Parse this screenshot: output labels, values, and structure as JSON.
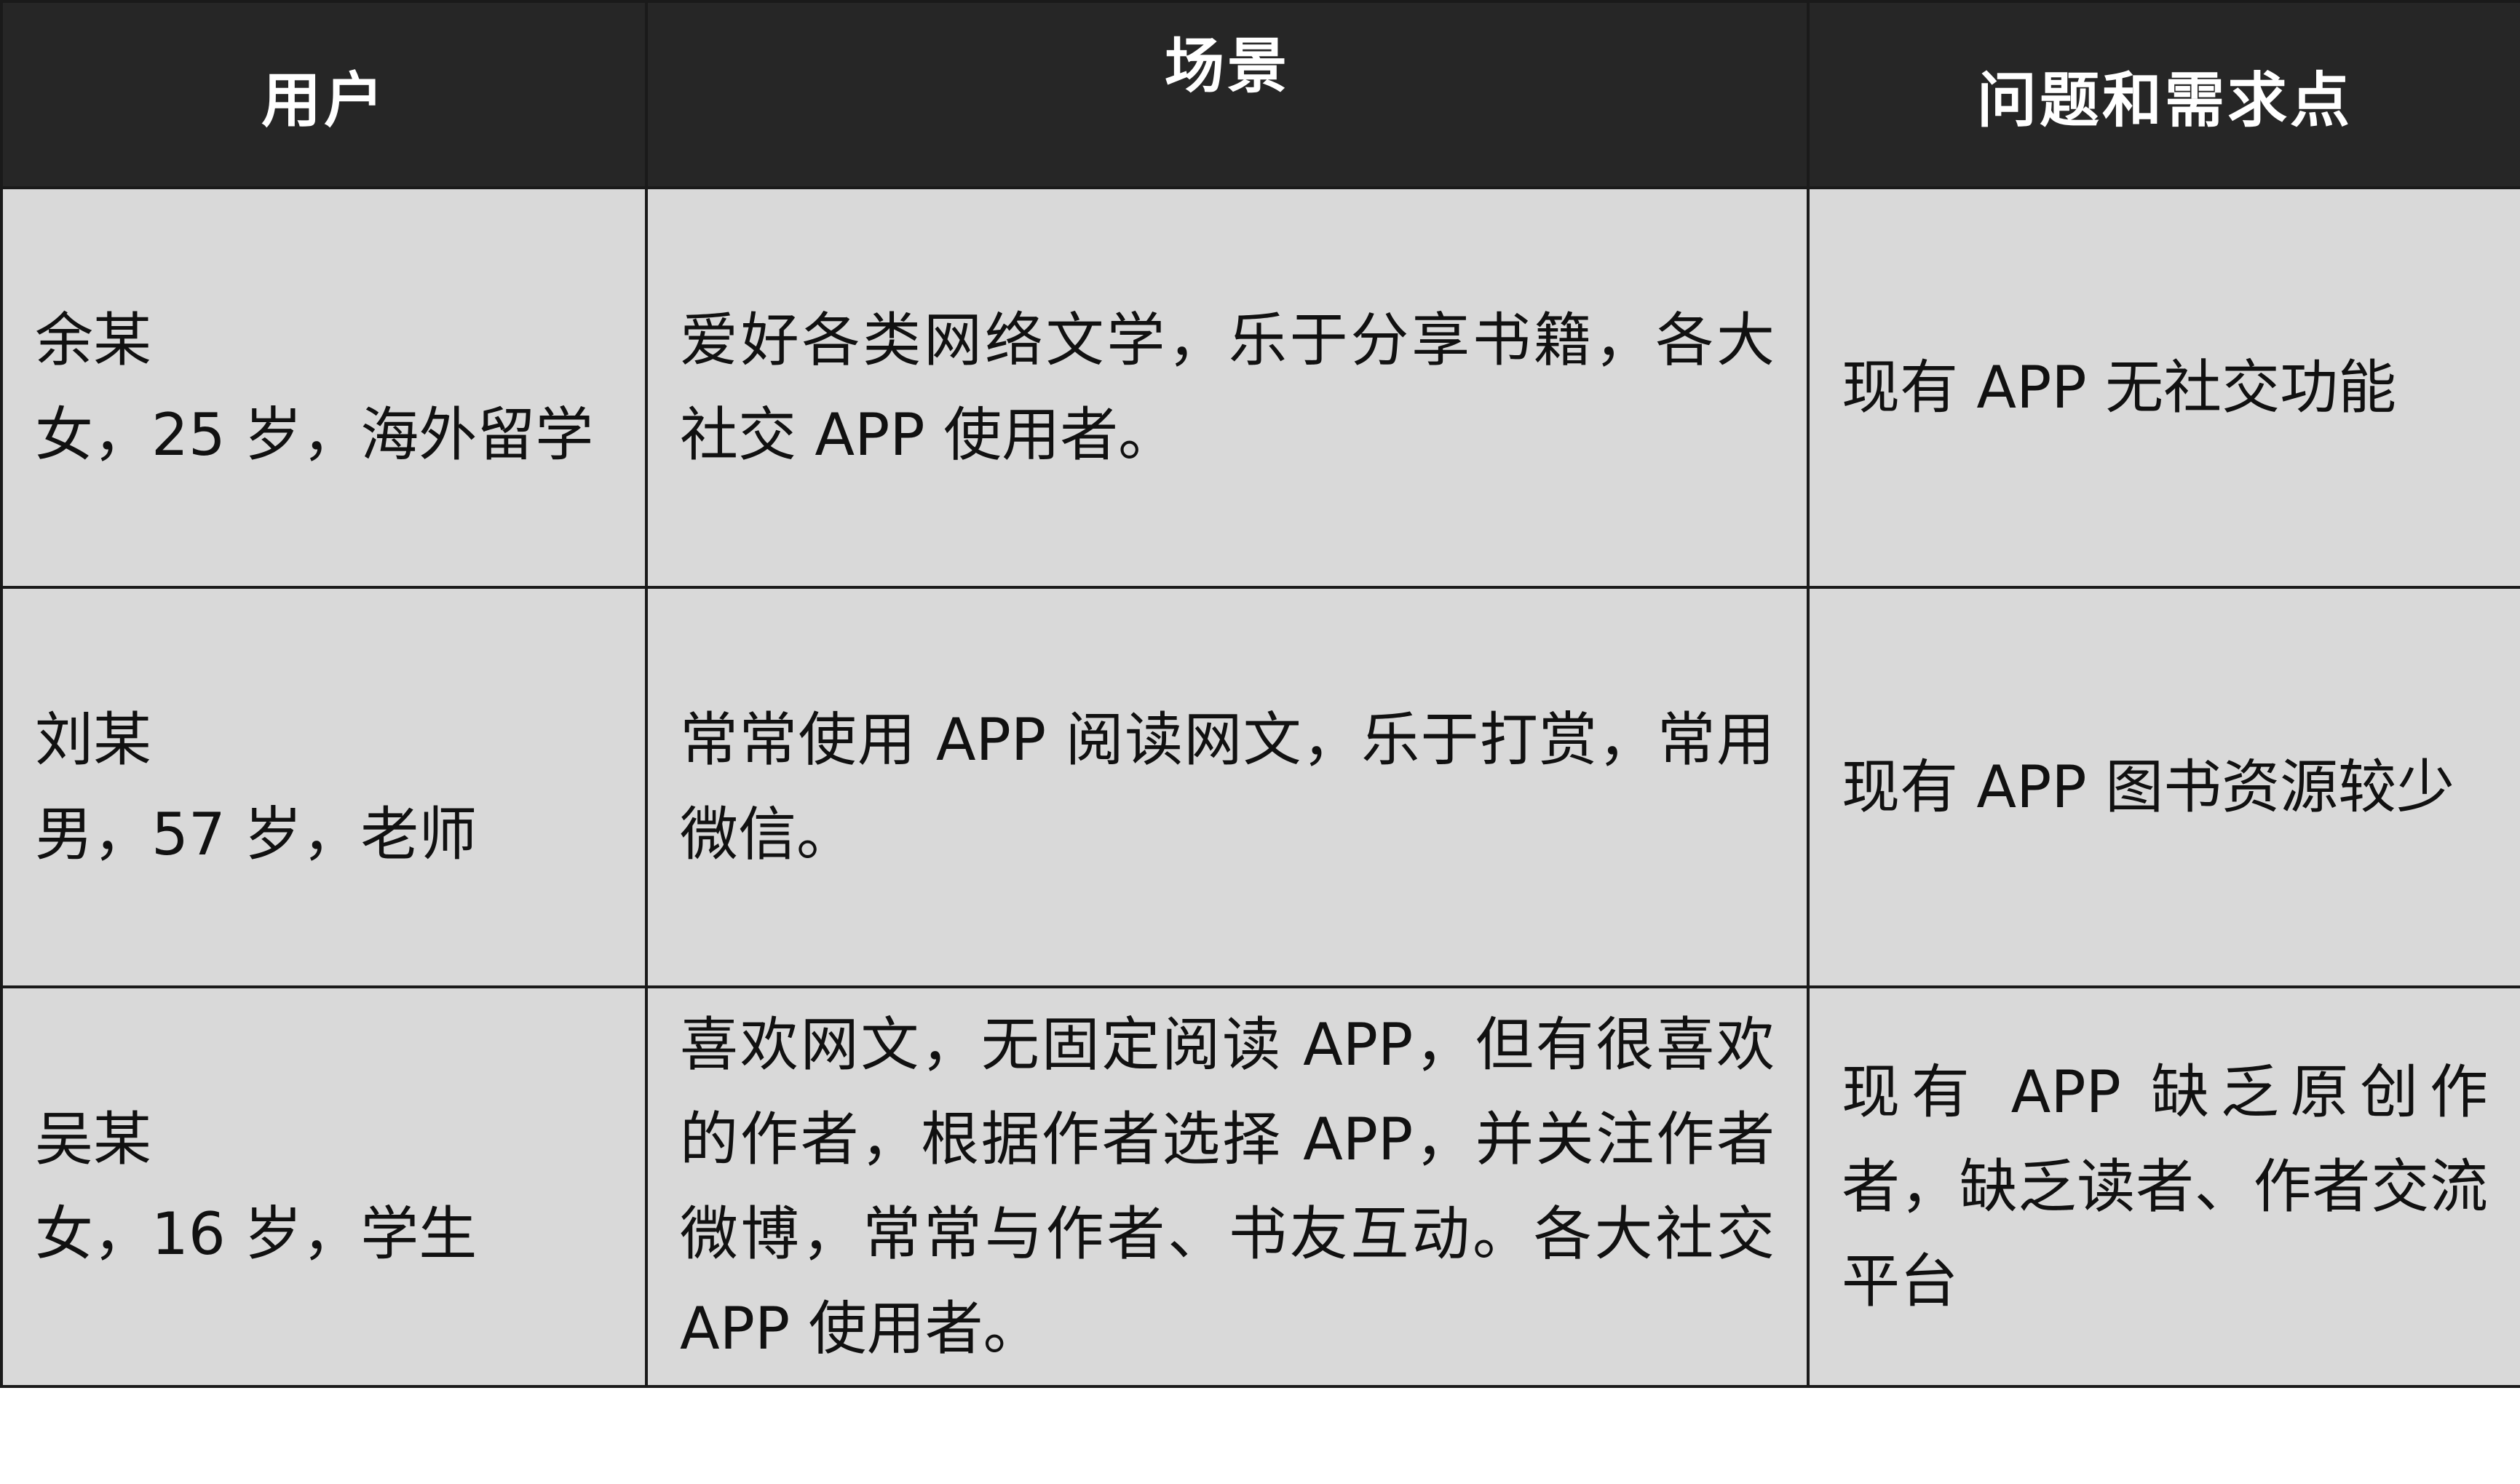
{
  "table": {
    "headers": {
      "user": "用户",
      "scene": "场景",
      "needs": "问题和需求点"
    },
    "rows": [
      {
        "user_name": "余某",
        "user_info": "女，25 岁，海外留学",
        "scene": "爱好各类网络文学，乐于分享书籍，各大社交 APP 使用者。",
        "needs": "现有 APP 无社交功能"
      },
      {
        "user_name": "刘某",
        "user_info": "男，57 岁，老师",
        "scene": "常常使用 APP 阅读网文，乐于打赏，常用微信。",
        "needs": "现有 APP 图书资源较少"
      },
      {
        "user_name": "吴某",
        "user_info": "女，16 岁，学生",
        "scene": "喜欢网文，无固定阅读 APP，但有很喜欢的作者，根据作者选择 APP，并关注作者微博，常常与作者、书友互动。各大社交 APP 使用者。",
        "needs": "现有 APP 缺乏原创作者，缺乏读者、作者交流平台"
      }
    ]
  }
}
